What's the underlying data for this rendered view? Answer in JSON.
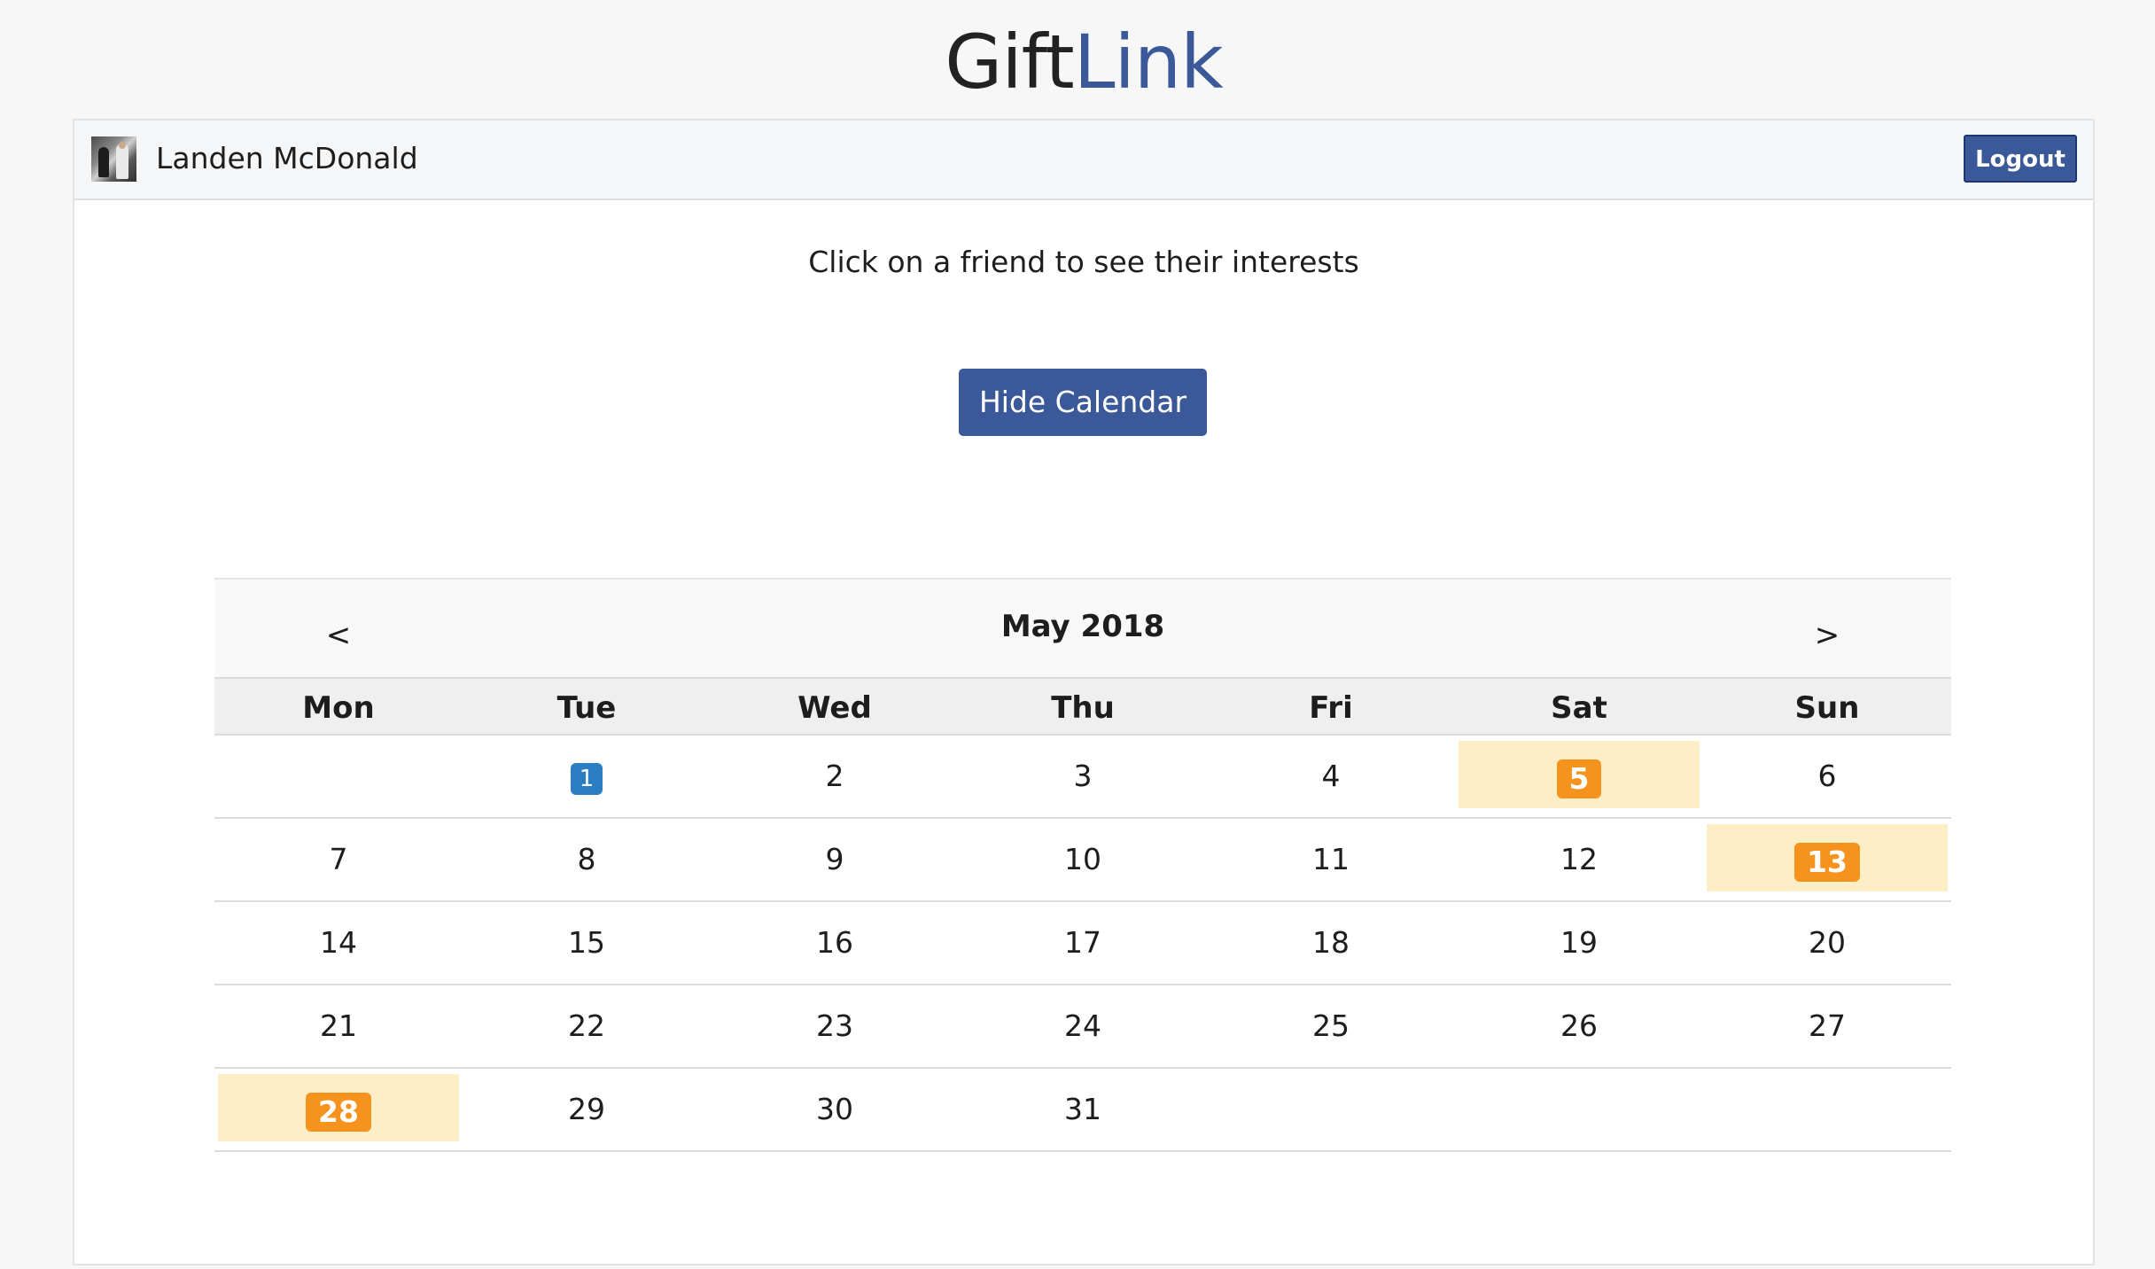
{
  "app": {
    "title_part1": "Gift",
    "title_part2": "Link",
    "title_color_1": "#222222",
    "title_color_2": "#3b5998"
  },
  "header": {
    "user_name": "Landen McDonald",
    "logout_label": "Logout",
    "accent_color": "#3b5998"
  },
  "main": {
    "instructions": "Click on a friend to see their interests",
    "hide_calendar_label": "Hide Calendar"
  },
  "calendar": {
    "month_label": "May 2018",
    "prev_label": "<",
    "next_label": ">",
    "weekdays": [
      "Mon",
      "Tue",
      "Wed",
      "Thu",
      "Fri",
      "Sat",
      "Sun"
    ],
    "weeks": [
      [
        "",
        "1",
        "2",
        "3",
        "4",
        "5",
        "6"
      ],
      [
        "7",
        "8",
        "9",
        "10",
        "11",
        "12",
        "13"
      ],
      [
        "14",
        "15",
        "16",
        "17",
        "18",
        "19",
        "20"
      ],
      [
        "21",
        "22",
        "23",
        "24",
        "25",
        "26",
        "27"
      ],
      [
        "28",
        "29",
        "30",
        "31",
        "",
        "",
        ""
      ]
    ],
    "today": "1",
    "event_days": [
      "5",
      "13",
      "28"
    ],
    "today_color": "#2c7dc1",
    "event_color": "#f6921e",
    "event_highlight_color": "#feeec5"
  }
}
